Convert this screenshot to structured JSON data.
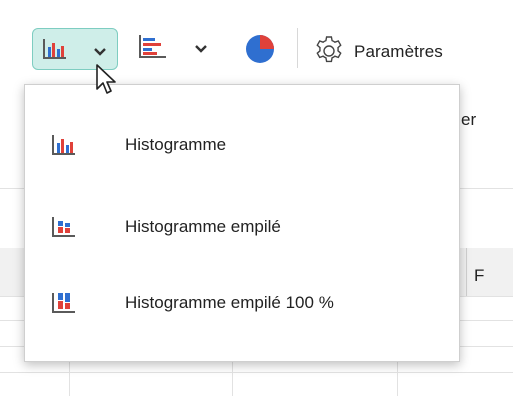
{
  "toolbar": {
    "chart_type_icon": "column-chart-icon",
    "dropdown_icon": "chevron-down-icon",
    "bar_chart_icon": "bar-chart-icon",
    "pie_chart_icon": "pie-chart-icon",
    "settings_icon": "gear-icon",
    "settings_label": "Paramètres",
    "accent_color": "#cfeee9"
  },
  "background": {
    "partial_label": "er",
    "column_letter": "F"
  },
  "menu": {
    "items": [
      {
        "label": "Histogramme",
        "icon": "clustered-column-icon"
      },
      {
        "label": "Histogramme empilé",
        "icon": "stacked-column-icon"
      },
      {
        "label": "Histogramme empilé 100 %",
        "icon": "stacked-column-100-icon"
      }
    ]
  },
  "colors": {
    "blue": "#2f6fd0",
    "red": "#e0413a",
    "axis": "#5a5a5a"
  }
}
